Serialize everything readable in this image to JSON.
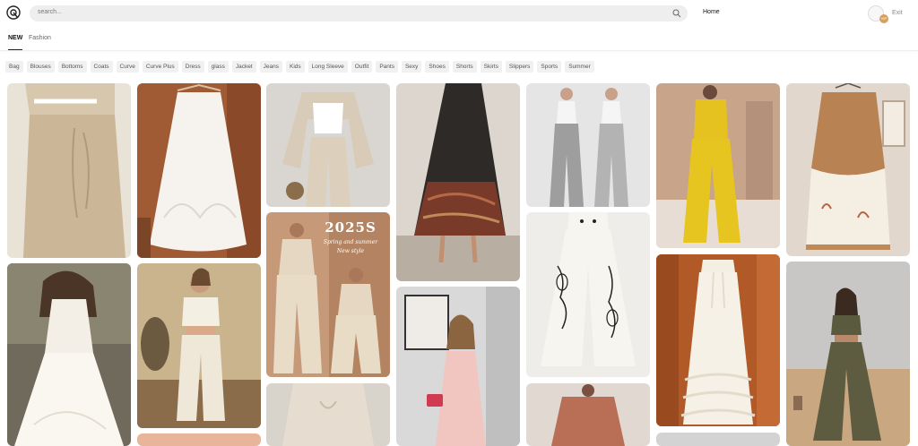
{
  "header": {
    "search_placeholder": "search...",
    "home_label": "Home",
    "exit_label": "Exit",
    "avatar_badge": "VIP"
  },
  "tabs": [
    {
      "label": "NEW",
      "active": true
    },
    {
      "label": "Fashion",
      "active": false
    }
  ],
  "categories": [
    "Bag",
    "Blouses",
    "Bottoms",
    "Coats",
    "Curve",
    "Curve Plus",
    "Dress",
    "glass",
    "Jacket",
    "Jeans",
    "Kids",
    "Long Sleeve",
    "Outfit",
    "Pants",
    "Sexy",
    "Shoes",
    "Shorts",
    "Skirts",
    "Slippers",
    "Sports",
    "Summer"
  ],
  "cards": [
    {
      "name": "beige-linen-pants-closeup"
    },
    {
      "name": "white-embroidered-skirt-on-hanger"
    },
    {
      "name": "beige-shirt-wide-pants-outfit"
    },
    {
      "name": "black-paisley-maxi-skirt"
    },
    {
      "name": "two-women-grey-wide-pants"
    },
    {
      "name": "yellow-top-and-pants-set"
    },
    {
      "name": "brown-white-layered-skirt"
    },
    {
      "name": "white-halter-maxi-dress"
    },
    {
      "name": "cream-crop-top-wide-pants"
    },
    {
      "name": "beige-vest-pants-set-promo",
      "overlay": {
        "year": "2025S",
        "line1": "Spring and summer",
        "line2": "New style"
      }
    },
    {
      "name": "white-pants-black-floral-print"
    },
    {
      "name": "pink-gingham-dress-selfie"
    },
    {
      "name": "cream-ruffle-wide-pants"
    },
    {
      "name": "olive-crop-top-flare-pants"
    },
    {
      "name": "light-blouse-knot-top"
    },
    {
      "name": "terracotta-blouse"
    },
    {
      "name": "peach-item-partial"
    },
    {
      "name": "grey-item-partial"
    }
  ],
  "colors": {
    "accent": "#d8a060",
    "search_bg": "#eeeeee",
    "chip_bg": "#f1f1f1"
  }
}
